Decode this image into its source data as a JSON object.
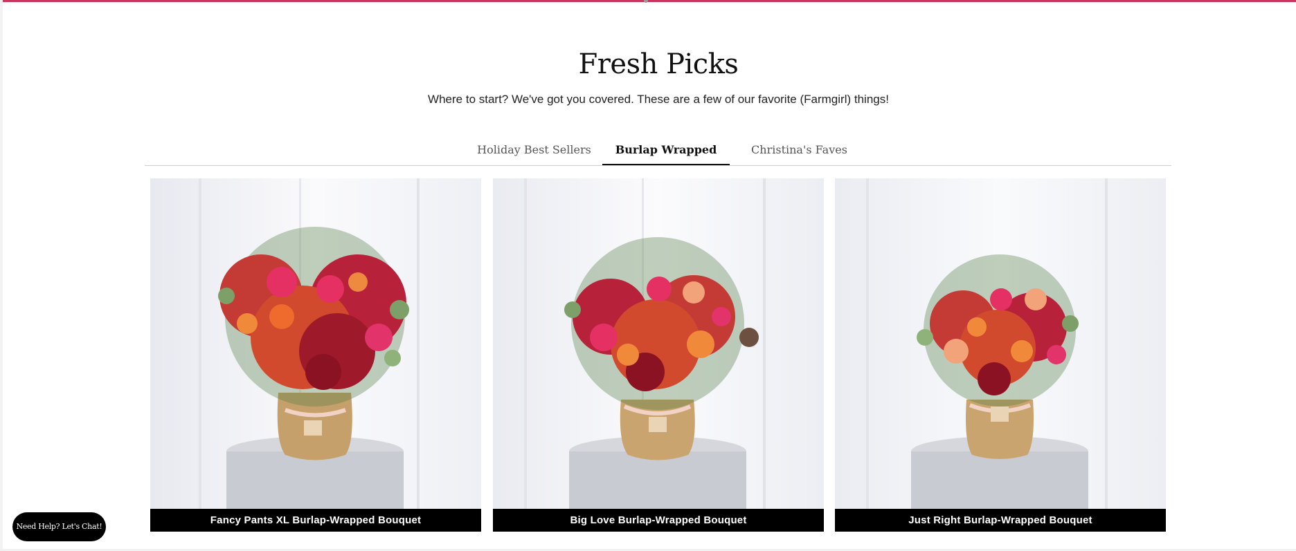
{
  "header": {
    "title": "Fresh Picks",
    "subtitle": "Where to start? We've got you covered. These are a few of our favorite (Farmgirl) things!"
  },
  "tabs": [
    {
      "label": "Holiday Best Sellers",
      "active": false
    },
    {
      "label": "Burlap Wrapped",
      "active": true
    },
    {
      "label": "Christina's Faves",
      "active": false
    }
  ],
  "products": [
    {
      "name": "Fancy Pants XL Burlap-Wrapped Bouquet"
    },
    {
      "name": "Big Love Burlap-Wrapped Bouquet"
    },
    {
      "name": "Just Right Burlap-Wrapped Bouquet"
    }
  ],
  "chat": {
    "label": "Need Help? Let's Chat!"
  },
  "colors": {
    "accent": "#c8345e",
    "caption_bg": "#000000"
  }
}
